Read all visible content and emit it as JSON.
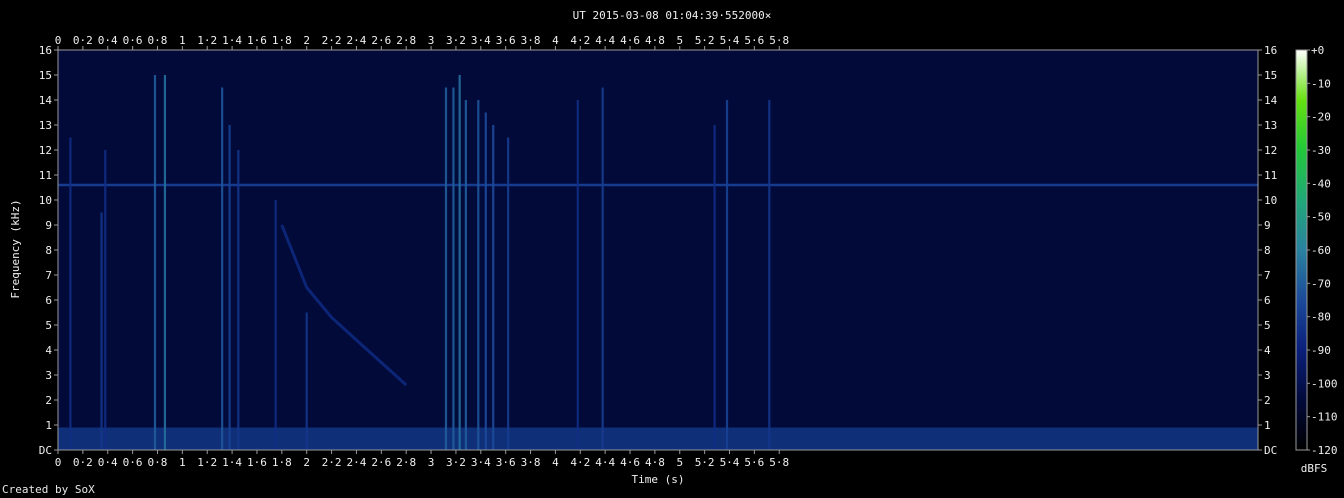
{
  "chart_data": {
    "type": "heatmap",
    "title": "UT 2015-03-08 01:04:39·552000×",
    "xlabel": "Time (s)",
    "ylabel": "Frequency (kHz)",
    "colorbar_label": "dBFS",
    "xlim": [
      0,
      9.65
    ],
    "ylim": [
      0,
      16
    ],
    "zlim": [
      -120,
      0
    ],
    "x_ticks": [
      "0",
      "0·2",
      "0·4",
      "0·6",
      "0·8",
      "1",
      "1·2",
      "1·4",
      "1·6",
      "1·8",
      "2",
      "2·2",
      "2·4",
      "2·6",
      "2·8",
      "3",
      "3·2",
      "3·4",
      "3·6",
      "3·8",
      "4",
      "4·2",
      "4·4",
      "4·6",
      "4·8",
      "5",
      "5·2",
      "5·4",
      "5·6",
      "5·8"
    ],
    "y_ticks": [
      "DC",
      "1",
      "2",
      "3",
      "4",
      "5",
      "6",
      "7",
      "8",
      "9",
      "10",
      "11",
      "12",
      "13",
      "14",
      "15",
      "16"
    ],
    "colorbar_ticks": [
      "+0",
      "-10",
      "-20",
      "-30",
      "-40",
      "-50",
      "-60",
      "-70",
      "-80",
      "-90",
      "-100",
      "-110",
      "-120"
    ],
    "features": {
      "background_db": -105,
      "low_band": {
        "from_khz": 0,
        "to_khz": 0.9,
        "db": -80
      },
      "tone": {
        "freq_khz": 10.6,
        "db": -80
      },
      "sweep": [
        {
          "t": 1.8,
          "f": 9.0
        },
        {
          "t": 2.0,
          "f": 6.5
        },
        {
          "t": 2.2,
          "f": 5.3
        },
        {
          "t": 2.4,
          "f": 4.4
        },
        {
          "t": 2.6,
          "f": 3.5
        },
        {
          "t": 2.8,
          "f": 2.6
        }
      ],
      "impulses": [
        {
          "t": 0.1,
          "fmax": 12.5,
          "db": -85
        },
        {
          "t": 0.35,
          "fmax": 9.5,
          "db": -82
        },
        {
          "t": 0.38,
          "fmax": 12.0,
          "db": -85
        },
        {
          "t": 0.78,
          "fmax": 15.0,
          "db": -70
        },
        {
          "t": 0.86,
          "fmax": 15.0,
          "db": -65
        },
        {
          "t": 1.32,
          "fmax": 14.5,
          "db": -72
        },
        {
          "t": 1.38,
          "fmax": 13.0,
          "db": -78
        },
        {
          "t": 1.45,
          "fmax": 12.0,
          "db": -82
        },
        {
          "t": 1.75,
          "fmax": 10.0,
          "db": -85
        },
        {
          "t": 2.0,
          "fmax": 5.5,
          "db": -82
        },
        {
          "t": 3.12,
          "fmax": 14.5,
          "db": -70
        },
        {
          "t": 3.18,
          "fmax": 14.5,
          "db": -70
        },
        {
          "t": 3.23,
          "fmax": 15.0,
          "db": -65
        },
        {
          "t": 3.28,
          "fmax": 14.0,
          "db": -70
        },
        {
          "t": 3.38,
          "fmax": 14.0,
          "db": -72
        },
        {
          "t": 3.44,
          "fmax": 13.5,
          "db": -75
        },
        {
          "t": 3.5,
          "fmax": 13.0,
          "db": -75
        },
        {
          "t": 3.62,
          "fmax": 12.5,
          "db": -80
        },
        {
          "t": 4.18,
          "fmax": 14.0,
          "db": -85
        },
        {
          "t": 4.38,
          "fmax": 14.5,
          "db": -80
        },
        {
          "t": 5.28,
          "fmax": 13.0,
          "db": -85
        },
        {
          "t": 5.38,
          "fmax": 14.0,
          "db": -78
        },
        {
          "t": 5.72,
          "fmax": 14.0,
          "db": -82
        }
      ]
    }
  },
  "colors": {
    "background": "#000000",
    "axis": "#9a9a9a",
    "text": "#f0f0f0",
    "colormap": [
      "#000000",
      "#020a3a",
      "#0a1f7a",
      "#1c4a9a",
      "#2a82a0",
      "#21a878",
      "#22c83a",
      "#66e010",
      "#ffffff"
    ]
  },
  "footer": {
    "credit": "Created by SoX"
  }
}
